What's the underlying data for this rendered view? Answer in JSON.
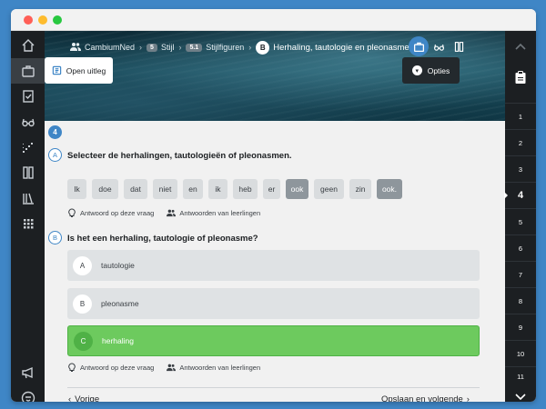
{
  "breadcrumbs": {
    "group": "CambiumNed",
    "chapter_badge": "5",
    "chapter": "Stijl",
    "section_badge": "5.1",
    "section": "Stijlfiguren",
    "lesson_badge": "B",
    "lesson": "Herhaling, tautologie en pleonasme"
  },
  "hero": {
    "open_explanation": "Open uitleg",
    "options": "Opties"
  },
  "question": {
    "number": "4",
    "part_a": {
      "letter": "A",
      "title": "Selecteer de herhalingen, tautologieën of pleonasmen.",
      "words": [
        {
          "text": "Ik",
          "selected": false
        },
        {
          "text": "doe",
          "selected": false
        },
        {
          "text": "dat",
          "selected": false
        },
        {
          "text": "niet",
          "selected": false
        },
        {
          "text": "en",
          "selected": false
        },
        {
          "text": "ik",
          "selected": false
        },
        {
          "text": "heb",
          "selected": false
        },
        {
          "text": "er",
          "selected": false
        },
        {
          "text": "ook",
          "selected": true
        },
        {
          "text": "geen",
          "selected": false
        },
        {
          "text": "zin",
          "selected": false
        },
        {
          "text": "ook.",
          "selected": true
        }
      ],
      "hint_answer": "Antwoord op deze vraag",
      "hint_students": "Antwoorden van leerlingen"
    },
    "part_b": {
      "letter": "B",
      "title": "Is het een herhaling, tautologie of pleonasme?",
      "options": [
        {
          "letter": "A",
          "label": "tautologie",
          "state": "default"
        },
        {
          "letter": "B",
          "label": "pleonasme",
          "state": "default"
        },
        {
          "letter": "C",
          "label": "herhaling",
          "state": "correct"
        }
      ],
      "hint_answer": "Antwoord op deze vraag",
      "hint_students": "Antwoorden van leerlingen"
    }
  },
  "footer": {
    "prev": "Vorige",
    "next": "Opslaan en volgende"
  },
  "question_nav": {
    "items": [
      "1",
      "2",
      "3",
      "4",
      "5",
      "6",
      "7",
      "8",
      "9",
      "10",
      "11"
    ],
    "current": "4"
  },
  "colors": {
    "accent": "#3f86c6",
    "correct": "#6dca5e",
    "sidebar": "#1c1f22"
  }
}
